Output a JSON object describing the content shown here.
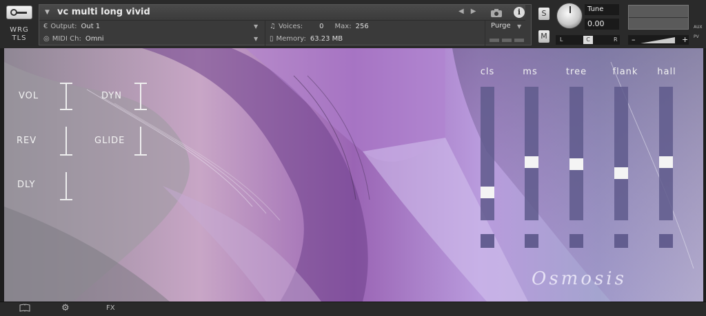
{
  "brand": {
    "line1": "WRG",
    "line2": "TLS"
  },
  "instrument": {
    "name": "vc multi long vivid",
    "output_label": "Output:",
    "output_value": "Out 1",
    "midi_label": "MIDI Ch:",
    "midi_value": "Omni",
    "voices_label": "Voices:",
    "voices_value": "0",
    "max_label": "Max:",
    "max_value": "256",
    "memory_label": "Memory:",
    "memory_value": "63.23 MB",
    "purge_label": "Purge",
    "info_label": "i"
  },
  "controls": {
    "solo": "S",
    "mute": "M",
    "tune_label": "Tune",
    "tune_value": "0.00",
    "pan_left": "L",
    "pan_right": "R",
    "pan_center": "C",
    "vol_minus": "–",
    "vol_plus": "+",
    "aux": "AUX",
    "pv": "PV"
  },
  "fx_controls": [
    {
      "label": "VOL"
    },
    {
      "label": "DYN"
    },
    {
      "label": "REV"
    },
    {
      "label": "GLIDE"
    },
    {
      "label": "DLY"
    }
  ],
  "mics": [
    {
      "label": "cls",
      "level": 0.18
    },
    {
      "label": "ms",
      "level": 0.43
    },
    {
      "label": "tree",
      "level": 0.41
    },
    {
      "label": "flank",
      "level": 0.34
    },
    {
      "label": "hall",
      "level": 0.43
    }
  ],
  "logo_text": "Osmosis",
  "bottom_bar": {
    "fx": "FX"
  }
}
